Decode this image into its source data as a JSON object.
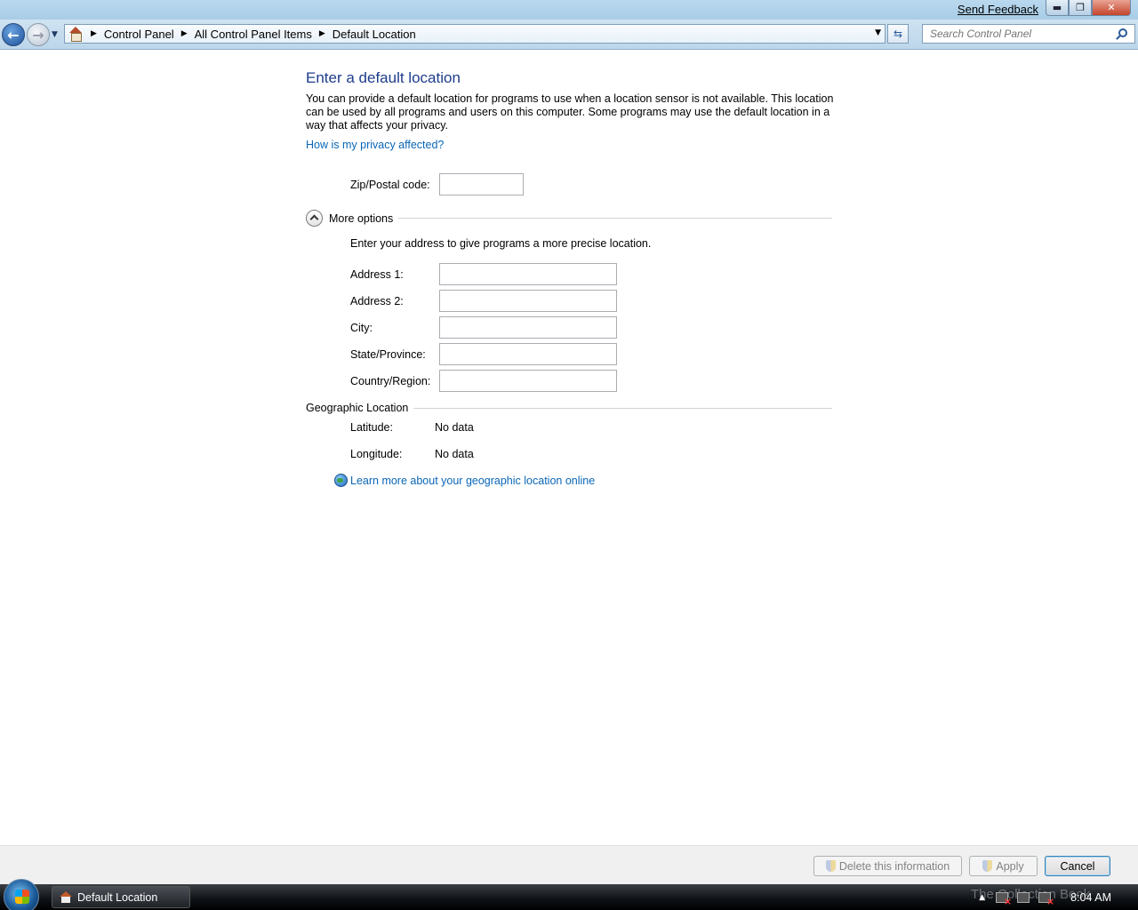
{
  "titlebar": {
    "feedback": "Send Feedback",
    "min": "▬",
    "max": "❐",
    "close": "✕"
  },
  "nav": {
    "breadcrumbs": [
      "Control Panel",
      "All Control Panel Items",
      "Default Location"
    ],
    "search_placeholder": "Search Control Panel"
  },
  "main": {
    "title": "Enter a default location",
    "description": "You can provide a default location for programs to use when a location sensor is not available. This location can be used by all programs and users on this computer. Some programs may use the default location in a way that affects your privacy.",
    "privacy_link": "How is my privacy affected?",
    "zip_label": "Zip/Postal code:",
    "zip_value": "",
    "more_options": "More options",
    "address_hint": "Enter your address to give programs a more precise location.",
    "fields": [
      {
        "label": "Address 1:",
        "value": ""
      },
      {
        "label": "Address 2:",
        "value": ""
      },
      {
        "label": "City:",
        "value": ""
      },
      {
        "label": "State/Province:",
        "value": ""
      },
      {
        "label": "Country/Region:",
        "value": ""
      }
    ],
    "geo_header": "Geographic Location",
    "latitude_label": "Latitude:",
    "latitude_value": "No data",
    "longitude_label": "Longitude:",
    "longitude_value": "No data",
    "geo_link": "Learn more about your geographic location online"
  },
  "buttons": {
    "delete": "Delete this information",
    "apply": "Apply",
    "cancel": "Cancel"
  },
  "taskbar": {
    "window_title": "Default Location",
    "watermark": "The Collection Book",
    "clock": "8:04 AM"
  }
}
